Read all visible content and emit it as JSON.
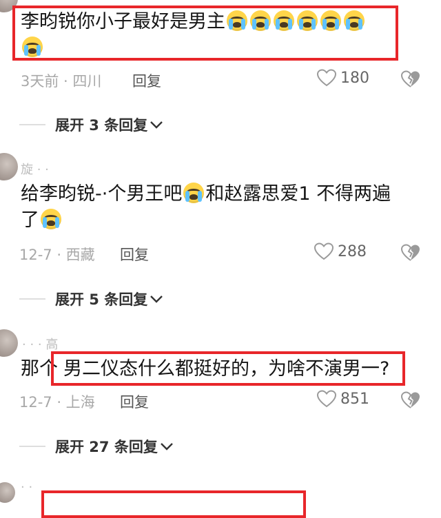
{
  "comments": [
    {
      "username": "",
      "text": "李昀锐你小子最好是男主",
      "emoji_count_line1": 6,
      "emoji_count_line2": 1,
      "meta": "3天前 · 四川",
      "reply": "回复",
      "likes": "180",
      "expand": "展开 3 条回复"
    },
    {
      "username": "旋 · ·",
      "text_line1": "给李昀锐-·个男王吧",
      "text_line1_after": "和赵露思爱1 不得两遍",
      "text_line2": "了",
      "meta": "12-7 · 西藏",
      "reply": "回复",
      "likes": "288",
      "expand": "展开 5 条回复"
    },
    {
      "username": "· · · 高",
      "text_prefix": "那个",
      "text_highlight": "男二仪态什么都挺好的，为啥不演男一?",
      "meta": "12-7 · 上海",
      "reply": "回复",
      "likes": "851",
      "expand": "展开 27 条回复"
    },
    {
      "username": "· ·"
    }
  ],
  "colors": {
    "highlight_box": "#e8262a",
    "meta_text": "#a8a8a8",
    "body_text": "#161616"
  },
  "icons": {
    "like": "heart-outline-icon",
    "dislike": "broken-heart-icon",
    "expand": "chevron-down-icon",
    "emoji": "crying-face-emoji"
  }
}
